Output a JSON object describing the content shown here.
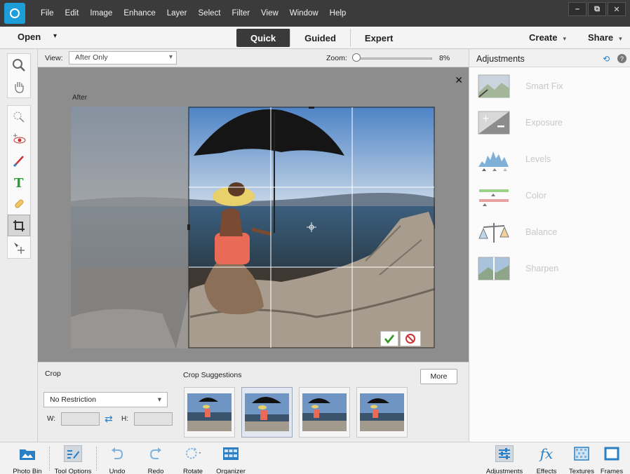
{
  "menu": [
    "File",
    "Edit",
    "Image",
    "Enhance",
    "Layer",
    "Select",
    "Filter",
    "View",
    "Window",
    "Help"
  ],
  "window_controls": [
    "–",
    "⧉",
    "✕"
  ],
  "modebar": {
    "open": "Open",
    "tabs": [
      "Quick",
      "Guided",
      "Expert"
    ],
    "active_tab": "Quick",
    "create": "Create",
    "share": "Share"
  },
  "options": {
    "view_label": "View:",
    "view_value": "After Only",
    "zoom_label": "Zoom:",
    "zoom_value": "8%",
    "zoom_fraction": 0.08
  },
  "canvas": {
    "after_label": "After",
    "close": "✕"
  },
  "crop_panel": {
    "title": "Crop",
    "suggestions_title": "Crop Suggestions",
    "more": "More",
    "restriction": "No Restriction",
    "w_label": "W:",
    "h_label": "H:",
    "w_value": "",
    "h_value": ""
  },
  "adjustments": {
    "title": "Adjustments",
    "items": [
      "Smart Fix",
      "Exposure",
      "Levels",
      "Color",
      "Balance",
      "Sharpen"
    ]
  },
  "bottom": {
    "left": [
      "Photo Bin",
      "Tool Options",
      "Undo",
      "Redo",
      "Rotate",
      "Organizer"
    ],
    "right": [
      "Adjustments",
      "Effects",
      "Textures",
      "Frames"
    ]
  },
  "colors": {
    "accent": "#2a7fc5",
    "menubar": "#3b3b3b",
    "canvas_bg": "#8d8d8d"
  }
}
